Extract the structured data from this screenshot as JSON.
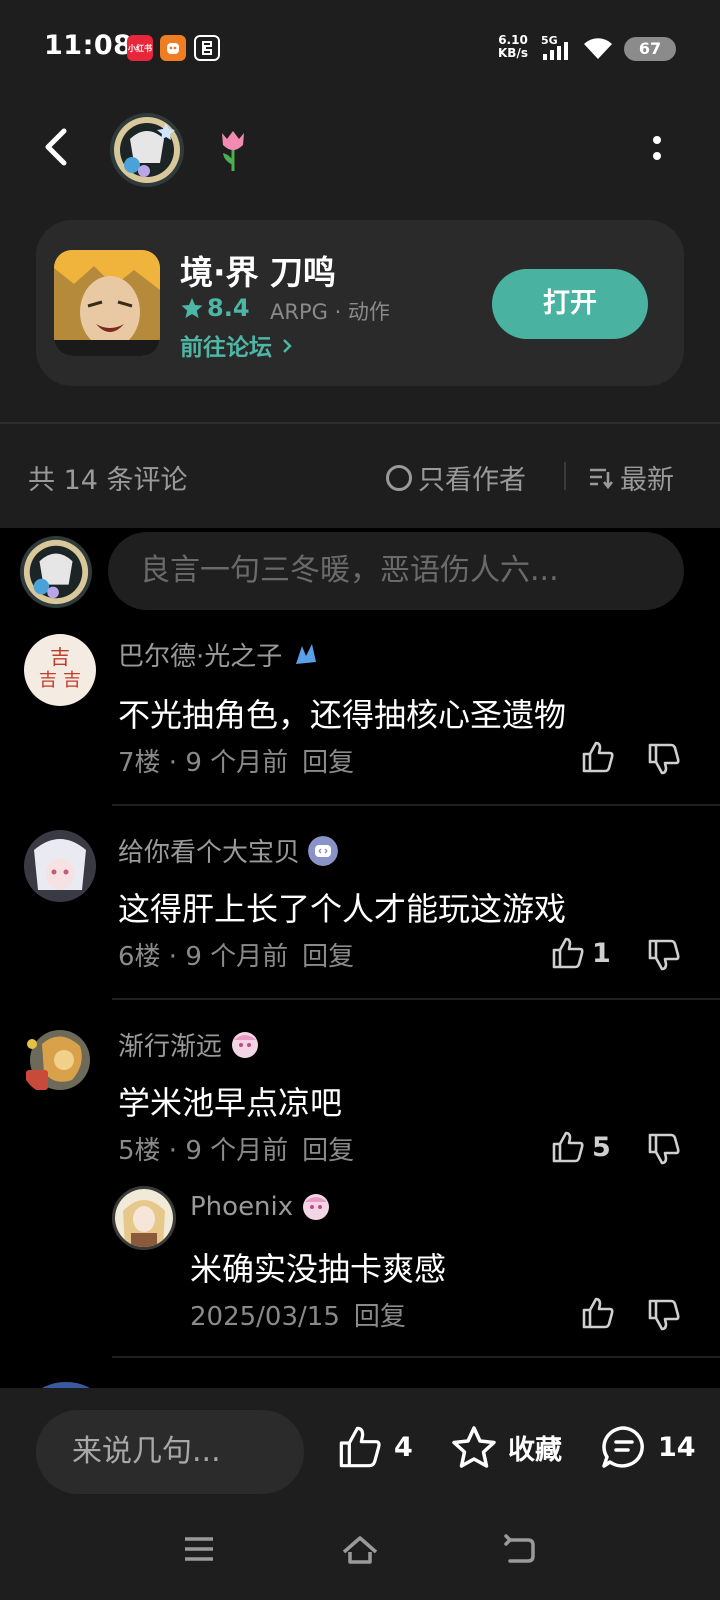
{
  "status_bar": {
    "time": "11:08",
    "app_icons": [
      "小红书",
      "",
      ""
    ],
    "net_speed_value": "6.10",
    "net_speed_unit": "KB/s",
    "network": "5G",
    "battery": "67"
  },
  "header": {
    "back_label": "",
    "more_label": ""
  },
  "app_card": {
    "name": "境·界 刀鸣",
    "rating": "8.4",
    "genre": "ARPG · 动作",
    "forum_link": "前往论坛",
    "open_button": "打开"
  },
  "sort_bar": {
    "count_label": "共 14 条评论",
    "only_author": "只看作者",
    "sort_newest": "最新"
  },
  "comment_box": {
    "placeholder": "良言一句三冬暖，恶语伤人六..."
  },
  "comments": [
    {
      "user": "巴尔德·光之子",
      "text": "不光抽角色，还得抽核心圣遗物",
      "floor": "7楼",
      "time": "9 个月前",
      "reply": "回复",
      "likes": ""
    },
    {
      "user": "给你看个大宝贝",
      "text": "这得肝上长了个人才能玩这游戏",
      "floor": "6楼",
      "time": "9 个月前",
      "reply": "回复",
      "likes": "1"
    },
    {
      "user": "渐行渐远",
      "text": "学米池早点凉吧",
      "floor": "5楼",
      "time": "9 个月前",
      "reply": "回复",
      "likes": "5"
    }
  ],
  "sub_reply": {
    "user": "Phoenix",
    "text": "米确实没抽卡爽感",
    "date": "2025/03/15",
    "reply": "回复",
    "likes": ""
  },
  "bottom_bar": {
    "say_placeholder": "来说几句...",
    "like_count": "4",
    "favorite_label": "收藏",
    "comment_count": "14"
  },
  "colors": {
    "accent": "#4ab2a0",
    "background": "#000000",
    "panel": "#1e1e1e",
    "card": "#2a2a2a",
    "muted_text": "#9a9a9a"
  }
}
